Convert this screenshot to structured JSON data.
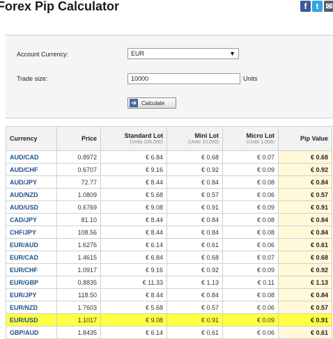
{
  "page": {
    "title": "Forex Pip Calculator"
  },
  "social": {
    "facebook": "f",
    "twitter": "t",
    "email": "✉"
  },
  "form": {
    "account_currency_label": "Account Currency:",
    "account_currency_value": "EUR",
    "trade_size_label": "Trade size:",
    "trade_size_value": "10000",
    "units_label": "Units",
    "calculate_label": "Calculate"
  },
  "table": {
    "headers": [
      {
        "label": "Currency",
        "sub": ""
      },
      {
        "label": "Price",
        "sub": ""
      },
      {
        "label": "Standard Lot",
        "sub": "(Units 100,000)"
      },
      {
        "label": "Mini Lot",
        "sub": "(Units 10,000)"
      },
      {
        "label": "Micro Lot",
        "sub": "(Units 1,000)"
      },
      {
        "label": "Pip Value",
        "sub": ""
      }
    ],
    "highlighted_pair": "EUR/USD",
    "rows": [
      {
        "pair": "AUD/CAD",
        "price": "0.8972",
        "standard": "€ 6.84",
        "mini": "€ 0.68",
        "micro": "€ 0.07",
        "pip": "€ 0.68"
      },
      {
        "pair": "AUD/CHF",
        "price": "0.6707",
        "standard": "€ 9.16",
        "mini": "€ 0.92",
        "micro": "€ 0.09",
        "pip": "€ 0.92"
      },
      {
        "pair": "AUD/JPY",
        "price": "72.77",
        "standard": "€ 8.44",
        "mini": "€ 0.84",
        "micro": "€ 0.08",
        "pip": "€ 0.84"
      },
      {
        "pair": "AUD/NZD",
        "price": "1.0809",
        "standard": "€ 5.68",
        "mini": "€ 0.57",
        "micro": "€ 0.06",
        "pip": "€ 0.57"
      },
      {
        "pair": "AUD/USD",
        "price": "0.6769",
        "standard": "€ 9.08",
        "mini": "€ 0.91",
        "micro": "€ 0.09",
        "pip": "€ 0.91"
      },
      {
        "pair": "CAD/JPY",
        "price": "81.10",
        "standard": "€ 8.44",
        "mini": "€ 0.84",
        "micro": "€ 0.08",
        "pip": "€ 0.84"
      },
      {
        "pair": "CHF/JPY",
        "price": "108.56",
        "standard": "€ 8.44",
        "mini": "€ 0.84",
        "micro": "€ 0.08",
        "pip": "€ 0.84"
      },
      {
        "pair": "EUR/AUD",
        "price": "1.6276",
        "standard": "€ 6.14",
        "mini": "€ 0.61",
        "micro": "€ 0.06",
        "pip": "€ 0.61"
      },
      {
        "pair": "EUR/CAD",
        "price": "1.4615",
        "standard": "€ 6.84",
        "mini": "€ 0.68",
        "micro": "€ 0.07",
        "pip": "€ 0.68"
      },
      {
        "pair": "EUR/CHF",
        "price": "1.0917",
        "standard": "€ 9.16",
        "mini": "€ 0.92",
        "micro": "€ 0.09",
        "pip": "€ 0.92"
      },
      {
        "pair": "EUR/GBP",
        "price": "0.8835",
        "standard": "€ 11.33",
        "mini": "€ 1.13",
        "micro": "€ 0.11",
        "pip": "€ 1.13"
      },
      {
        "pair": "EUR/JPY",
        "price": "118.50",
        "standard": "€ 8.44",
        "mini": "€ 0.84",
        "micro": "€ 0.08",
        "pip": "€ 0.84"
      },
      {
        "pair": "EUR/NZD",
        "price": "1.7603",
        "standard": "€ 5.68",
        "mini": "€ 0.57",
        "micro": "€ 0.06",
        "pip": "€ 0.57"
      },
      {
        "pair": "EUR/USD",
        "price": "1.1017",
        "standard": "€ 9.08",
        "mini": "€ 0.91",
        "micro": "€ 0.09",
        "pip": "€ 0.91"
      },
      {
        "pair": "GBP/AUD",
        "price": "1.8435",
        "standard": "€ 6.14",
        "mini": "€ 0.61",
        "micro": "€ 0.06",
        "pip": "€ 0.61"
      }
    ]
  },
  "colors": {
    "highlight": "#ffff44",
    "pip_column": "#fff8d9",
    "pair_link": "#1f4e8c"
  }
}
